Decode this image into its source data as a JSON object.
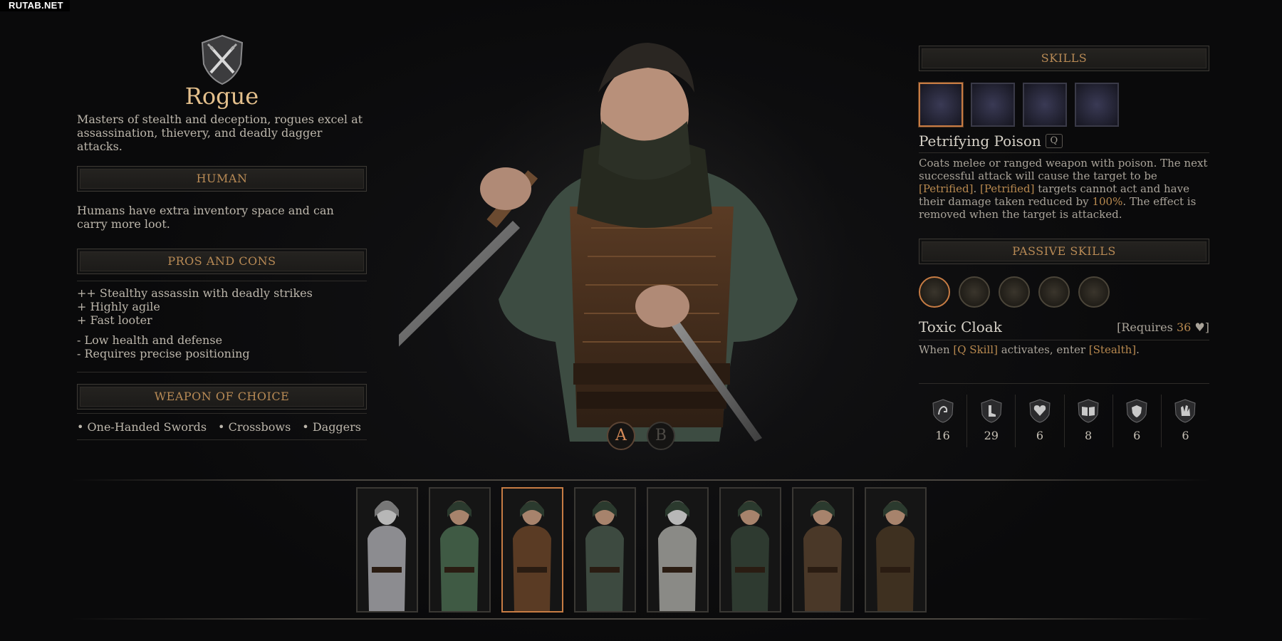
{
  "watermark": "RUTAB.NET",
  "class": {
    "name": "Rogue",
    "description": "Masters of stealth and deception, rogues excel at assassination, thievery, and deadly dagger attacks."
  },
  "race": {
    "header": "HUMAN",
    "description": "Humans have extra inventory space and can carry more loot."
  },
  "pros_cons": {
    "header": "PROS AND CONS",
    "pros": [
      "++ Stealthy assassin with deadly strikes",
      "+ Highly agile",
      "+ Fast looter"
    ],
    "cons": [
      "- Low health and defense",
      "- Requires precise positioning"
    ]
  },
  "weapons": {
    "header": "WEAPON OF CHOICE",
    "items": [
      "• One-Handed Swords",
      "• Crossbows",
      "• Daggers"
    ]
  },
  "loadout": {
    "a": "A",
    "b": "B",
    "selected": "A"
  },
  "skills": {
    "header": "SKILLS",
    "icons": [
      "poison-skill-icon",
      "blade-burst-skill-icon",
      "hooded-skill-icon",
      "rose-skill-icon"
    ],
    "selected_index": 0,
    "selected": {
      "name": "Petrifying Poison",
      "key": "Q",
      "desc": {
        "p1": "Coats melee or ranged weapon with poison. The next successful attack will cause the target to be ",
        "t1": "[Petrified]",
        "p2": ". ",
        "t2": "[Petrified]",
        "p3": " targets cannot act and have their damage taken reduced by ",
        "t3": "100%",
        "p4": ". The effect is removed when the target is attacked."
      }
    }
  },
  "passive": {
    "header": "PASSIVE SKILLS",
    "icons": [
      "toxic-cloak-icon",
      "passive-2-icon",
      "passive-3-icon",
      "passive-4-icon",
      "passive-5-icon"
    ],
    "selected_index": 0,
    "selected": {
      "name": "Toxic Cloak",
      "requires_prefix": "[Requires ",
      "requires_value": "36",
      "requires_suffix": "]",
      "desc": {
        "p1": "When ",
        "t1": "[Q Skill]",
        "p2": " activates, enter ",
        "t2": "[Stealth]",
        "p3": "."
      }
    }
  },
  "stats": [
    {
      "icon": "strength-icon",
      "value": "16"
    },
    {
      "icon": "agility-icon",
      "value": "29"
    },
    {
      "icon": "vitality-icon",
      "value": "6"
    },
    {
      "icon": "knowledge-icon",
      "value": "8"
    },
    {
      "icon": "resourcefulness-icon",
      "value": "6"
    },
    {
      "icon": "will-icon",
      "value": "6"
    }
  ],
  "characters": [
    {
      "name": "character-knight-card"
    },
    {
      "name": "character-ranger-card"
    },
    {
      "name": "character-rogue-card"
    },
    {
      "name": "character-hooded-card"
    },
    {
      "name": "character-skeleton-card"
    },
    {
      "name": "character-skull-hood-card"
    },
    {
      "name": "character-leather-card"
    },
    {
      "name": "character-archer-card"
    }
  ],
  "selected_character_index": 2,
  "colors": {
    "accent": "#c77c44",
    "gold": "#e4c08c",
    "header_text": "#b88a55",
    "highlight": "#b8894f"
  }
}
